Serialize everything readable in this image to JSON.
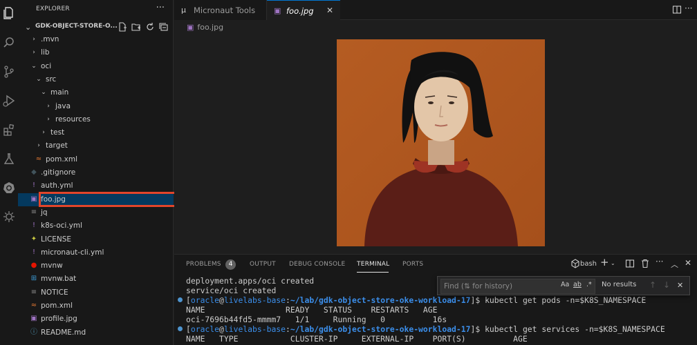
{
  "explorer": {
    "title": "EXPLORER",
    "more": "···",
    "root": "GDK-OBJECT-STORE-O...",
    "items": [
      {
        "label": ".mvn",
        "depth": 1,
        "kind": "folder",
        "expanded": false,
        "icon": ""
      },
      {
        "label": "lib",
        "depth": 1,
        "kind": "folder",
        "expanded": false,
        "icon": ""
      },
      {
        "label": "oci",
        "depth": 1,
        "kind": "folder",
        "expanded": true,
        "icon": ""
      },
      {
        "label": "src",
        "depth": 2,
        "kind": "folder",
        "expanded": true,
        "icon": ""
      },
      {
        "label": "main",
        "depth": 3,
        "kind": "folder",
        "expanded": true,
        "icon": ""
      },
      {
        "label": "java",
        "depth": 4,
        "kind": "folder",
        "expanded": false,
        "icon": ""
      },
      {
        "label": "resources",
        "depth": 4,
        "kind": "folder",
        "expanded": false,
        "icon": ""
      },
      {
        "label": "test",
        "depth": 3,
        "kind": "folder",
        "expanded": false,
        "icon": ""
      },
      {
        "label": "target",
        "depth": 2,
        "kind": "folder",
        "expanded": false,
        "icon": ""
      },
      {
        "label": "pom.xml",
        "depth": 2,
        "kind": "file",
        "icon": "rss-icon",
        "icon_glyph": "≈",
        "icon_color": "#e37933"
      },
      {
        "label": ".gitignore",
        "depth": 1,
        "kind": "file",
        "icon": "git-icon",
        "icon_glyph": "◆",
        "icon_color": "#41535b"
      },
      {
        "label": "auth.yml",
        "depth": 1,
        "kind": "file",
        "icon": "exclamation-icon",
        "icon_glyph": "!",
        "icon_color": "#a074c4"
      },
      {
        "label": "foo.jpg",
        "depth": 1,
        "kind": "file",
        "icon": "image-icon",
        "icon_glyph": "▣",
        "icon_color": "#a074c4",
        "selected": true
      },
      {
        "label": "jq",
        "depth": 1,
        "kind": "file",
        "icon": "text-file-icon",
        "icon_glyph": "≡",
        "icon_color": "#8b8b8b"
      },
      {
        "label": "k8s-oci.yml",
        "depth": 1,
        "kind": "file",
        "icon": "exclamation-icon",
        "icon_glyph": "!",
        "icon_color": "#a074c4"
      },
      {
        "label": "LICENSE",
        "depth": 1,
        "kind": "file",
        "icon": "license-icon",
        "icon_glyph": "✦",
        "icon_color": "#cbcb41"
      },
      {
        "label": "micronaut-cli.yml",
        "depth": 1,
        "kind": "file",
        "icon": "exclamation-icon",
        "icon_glyph": "!",
        "icon_color": "#a074c4"
      },
      {
        "label": "mvnw",
        "depth": 1,
        "kind": "file",
        "icon": "pin-icon",
        "icon_glyph": "●",
        "icon_color": "#e51400"
      },
      {
        "label": "mvnw.bat",
        "depth": 1,
        "kind": "file",
        "icon": "windows-icon",
        "icon_glyph": "⊞",
        "icon_color": "#3c9bd6"
      },
      {
        "label": "NOTICE",
        "depth": 1,
        "kind": "file",
        "icon": "text-file-icon",
        "icon_glyph": "≡",
        "icon_color": "#8b8b8b"
      },
      {
        "label": "pom.xml",
        "depth": 1,
        "kind": "file",
        "icon": "rss-icon",
        "icon_glyph": "≈",
        "icon_color": "#e37933"
      },
      {
        "label": "profile.jpg",
        "depth": 1,
        "kind": "file",
        "icon": "image-icon",
        "icon_glyph": "▣",
        "icon_color": "#a074c4"
      },
      {
        "label": "README.md",
        "depth": 1,
        "kind": "file",
        "icon": "info-icon",
        "icon_glyph": "ⓘ",
        "icon_color": "#519aba"
      }
    ]
  },
  "tabs": [
    {
      "label": "Micronaut Tools",
      "icon_glyph": "µ"
    },
    {
      "label": "foo.jpg",
      "icon_glyph": "▣",
      "close": "✕"
    }
  ],
  "breadcrumb": {
    "file": "foo.jpg"
  },
  "panel": {
    "tabs": [
      "PROBLEMS",
      "OUTPUT",
      "DEBUG CONSOLE",
      "TERMINAL",
      "PORTS"
    ],
    "problems_count": "4",
    "active_tab": "TERMINAL",
    "shell": "bash"
  },
  "terminal": {
    "lines": [
      {
        "text": "deployment.apps/oci created"
      },
      {
        "text": "service/oci created"
      },
      {
        "prompt": true,
        "user": "oracle",
        "host": "livelabs-base",
        "path": "~/lab/gdk-object-store-oke-workload-17",
        "cmd": "kubectl get pods -n=$K8S_NAMESPACE"
      },
      {
        "text": "NAME                 READY   STATUS    RESTARTS   AGE"
      },
      {
        "text": "oci-7696b44fd5-mmmm7   1/1     Running   0          16s"
      },
      {
        "prompt": true,
        "user": "oracle",
        "host": "livelabs-base",
        "path": "~/lab/gdk-object-store-oke-workload-17",
        "cmd": "kubectl get services -n=$K8S_NAMESPACE"
      },
      {
        "text": "NAME   TYPE           CLUSTER-IP     EXTERNAL-IP    PORT(S)          AGE"
      }
    ]
  },
  "find_widget": {
    "placeholder": "Find (⇅ for history)",
    "match_case": "Aa",
    "whole_word": "ab",
    "regex": ".*",
    "result": "No results"
  },
  "colors": {
    "accent": "#0078d4",
    "highlight_box": "#e2452a",
    "prompt_blue": "#3b8eea",
    "portrait_bg": "#b45a1f",
    "portrait_shirt": "#5a1e17",
    "portrait_collar": "#9e3324",
    "portrait_skin": "#e3c6a8"
  }
}
